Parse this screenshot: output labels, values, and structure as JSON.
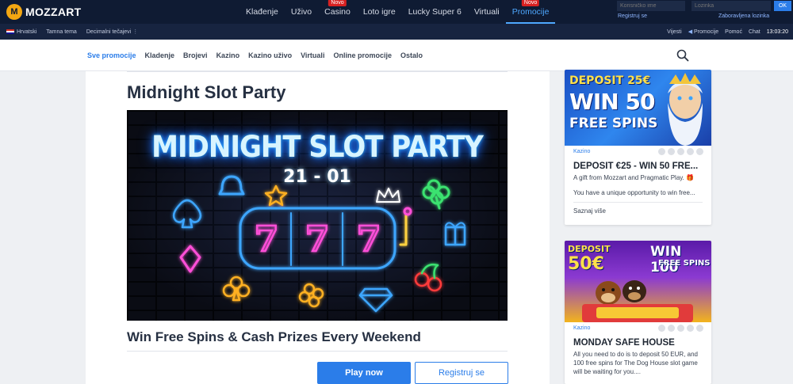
{
  "brand": {
    "logo_mark": "M",
    "name": "MOZZART"
  },
  "main_nav": [
    {
      "label": "Klađenje",
      "badge": ""
    },
    {
      "label": "Uživo",
      "badge": ""
    },
    {
      "label": "Casino",
      "badge": "Novo"
    },
    {
      "label": "Loto igre",
      "badge": ""
    },
    {
      "label": "Lucky Super 6",
      "badge": ""
    },
    {
      "label": "Virtuali",
      "badge": ""
    },
    {
      "label": "Promocije",
      "badge": "Novo",
      "active": true
    }
  ],
  "login": {
    "username_placeholder": "Korisničko ime",
    "password_placeholder": "Lozinka",
    "ok_label": "OK",
    "register_label": "Registruj se",
    "forgot_label": "Zaboravljena lozinka"
  },
  "subbar": {
    "language": "Hrvatski",
    "theme": "Tamna tema",
    "odds": "Decimalni tečajevi",
    "news": "Vijesti",
    "promotions": "Promocije",
    "help": "Pomoć",
    "chat": "Chat",
    "time": "13:03:20"
  },
  "promo_tabs": [
    {
      "label": "Sve promocije",
      "active": true
    },
    {
      "label": "Kladenje"
    },
    {
      "label": "Brojevi"
    },
    {
      "label": "Kazino"
    },
    {
      "label": "Kazino uživo"
    },
    {
      "label": "Virtuali"
    },
    {
      "label": "Online promocije"
    },
    {
      "label": "Ostalo"
    }
  ],
  "main": {
    "title": "Midnight Slot Party",
    "banner": {
      "headline": "MIDNIGHT SLOT PARTY",
      "date": "21 - 01",
      "reels": [
        "7",
        "7",
        "7"
      ]
    },
    "subtitle": "Win Free Spins & Cash Prizes Every Weekend",
    "play_label": "Play now",
    "register_label": "Registruj se"
  },
  "sidebar_cards": [
    {
      "image_lines": [
        "DEPOSIT 25€",
        "WIN 50",
        "FREE SPINS"
      ],
      "category": "Kazino",
      "title": "DEPOSIT €25 - WIN 50 FRE...",
      "desc_1": "A gift from Mozzart and Pragmatic Play. 🎁",
      "desc_2": "You have a unique opportunity to win free...",
      "more": "Saznaj više"
    },
    {
      "image_lines": [
        "DEPOSIT",
        "50€",
        "WIN 100",
        "FREE SPINS"
      ],
      "category": "Kazino",
      "title": "MONDAY SAFE HOUSE",
      "desc_1": "All you need to do is to deposit 50 EUR, and 100 free spins for The Dog House slot game will be waiting for you...."
    }
  ],
  "colors": {
    "accent": "#2b7de9",
    "topbar": "#0f1b33",
    "subbar": "#172440",
    "badge": "#d82121",
    "logo": "#f3a712"
  }
}
